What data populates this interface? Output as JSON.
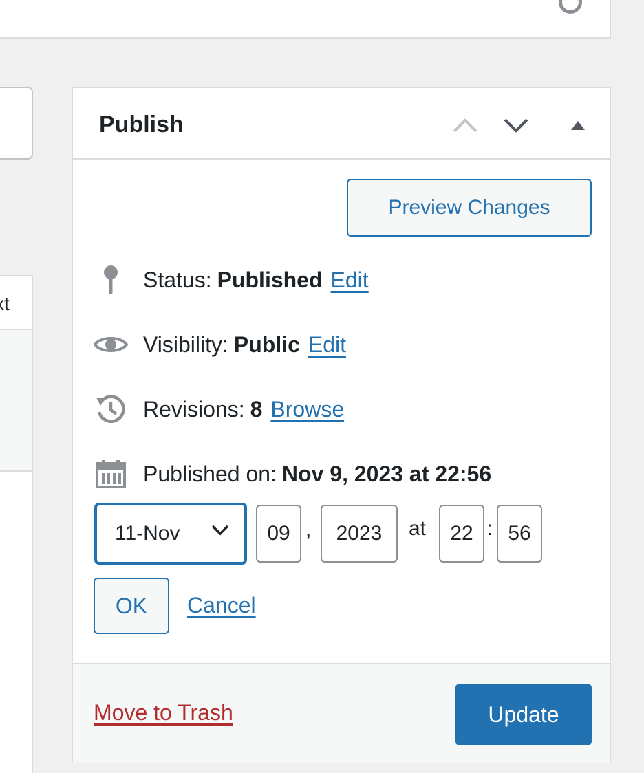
{
  "background": {
    "side_panel_fragment": "xt"
  },
  "publish": {
    "title": "Publish",
    "header_icons": [
      "chevron-up-icon",
      "chevron-down-icon",
      "triangle-up-icon"
    ],
    "preview_label": "Preview Changes",
    "status": {
      "label": "Status:",
      "value": "Published",
      "link": "Edit",
      "icon": "pin-icon"
    },
    "visibility": {
      "label": "Visibility:",
      "value": "Public",
      "link": "Edit",
      "icon": "eye-icon"
    },
    "revisions": {
      "label": "Revisions:",
      "value": "8",
      "link": "Browse",
      "icon": "history-icon"
    },
    "published_on": {
      "label": "Published on:",
      "value": "Nov 9, 2023 at 22:56",
      "icon": "calendar-icon"
    },
    "date_editor": {
      "month": "11-Nov",
      "day": "09",
      "comma": ",",
      "year": "2023",
      "at": "at",
      "hour": "22",
      "colon": ":",
      "minute": "56"
    },
    "ok_label": "OK",
    "cancel_label": "Cancel",
    "trash_label": "Move to Trash",
    "update_label": "Update"
  },
  "colors": {
    "accent": "#2271b1",
    "danger": "#b32d2e",
    "border": "#dcdcde",
    "background": "#f0f0f1"
  }
}
